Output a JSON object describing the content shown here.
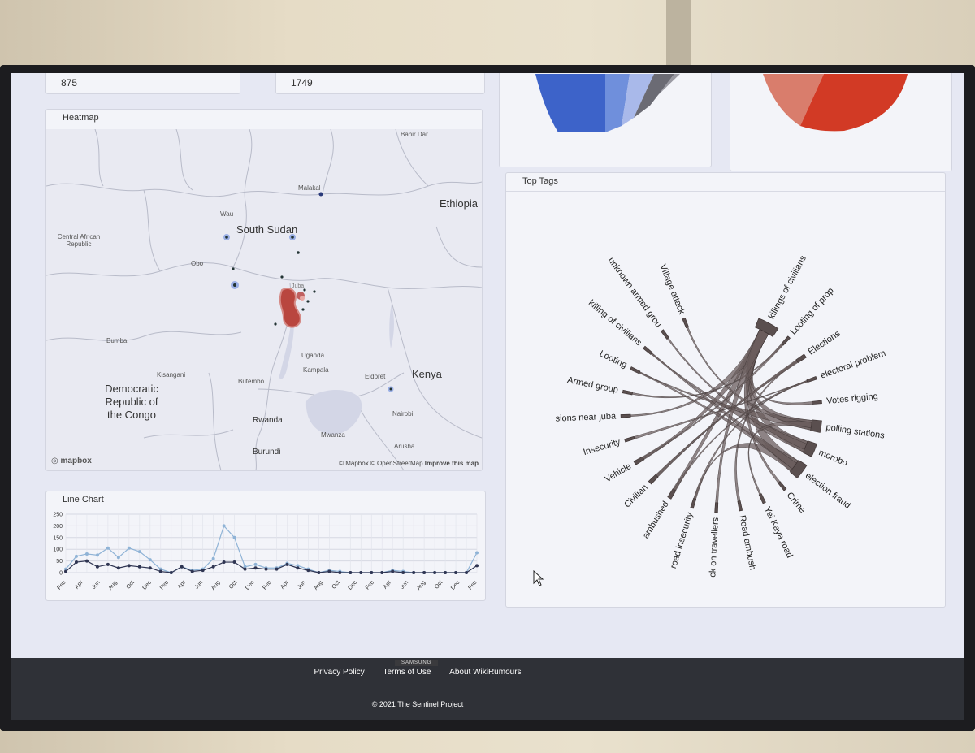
{
  "stats": {
    "left_value": "875",
    "right_value": "1749"
  },
  "heatmap": {
    "title": "Heatmap",
    "labels": {
      "south_sudan": "South Sudan",
      "ethiopia": "Ethiopia",
      "car": "Central African Republic",
      "drc": "Democratic Republic of the Congo",
      "uganda": "Uganda",
      "kenya": "Kenya",
      "rwanda": "Rwanda",
      "burundi": "Burundi",
      "bahir_dar": "Bahir Dar",
      "malakal": "Malakal",
      "wau": "Wau",
      "obo": "Obo",
      "bumba": "Bumba",
      "kisangani": "Kisangani",
      "butembo": "Butembo",
      "kampala": "Kampala",
      "eldoret": "Eldoret",
      "nairobi": "Nairobi",
      "mwanza": "Mwanza",
      "arusha": "Arusha",
      "juba": "Juba"
    },
    "logo": "mapbox",
    "attribution": {
      "mapbox": "© Mapbox",
      "osm": "© OpenStreetMap",
      "improve": "Improve this map"
    }
  },
  "line_chart": {
    "title": "Line Chart",
    "chart_data": {
      "type": "line",
      "y_ticks": [
        0,
        50,
        100,
        150,
        200,
        250
      ],
      "ylim": [
        0,
        250
      ],
      "x_labels": [
        "Feb",
        "Apr",
        "Jun",
        "Aug",
        "Oct",
        "Dec",
        "Feb",
        "Apr",
        "Jun",
        "Aug",
        "Oct",
        "Dec",
        "Feb",
        "Apr",
        "Jun",
        "Aug",
        "Oct",
        "Dec",
        "Feb",
        "Apr",
        "Jun",
        "Aug",
        "Oct",
        "Dec",
        "Feb"
      ],
      "series": [
        {
          "color": "#8fb3d6",
          "values": [
            15,
            70,
            80,
            75,
            105,
            65,
            105,
            90,
            55,
            15,
            0,
            25,
            10,
            15,
            60,
            200,
            150,
            25,
            35,
            20,
            20,
            40,
            30,
            15,
            0,
            10,
            5,
            0,
            0,
            0,
            0,
            10,
            5,
            0,
            0,
            0,
            0,
            0,
            0,
            85
          ]
        },
        {
          "color": "#2f3552",
          "values": [
            5,
            45,
            50,
            25,
            35,
            20,
            30,
            25,
            20,
            5,
            0,
            25,
            5,
            10,
            25,
            45,
            45,
            15,
            20,
            15,
            15,
            35,
            20,
            10,
            0,
            5,
            0,
            0,
            0,
            0,
            0,
            5,
            0,
            0,
            0,
            0,
            0,
            0,
            0,
            30
          ]
        }
      ]
    }
  },
  "top_tags": {
    "title": "Top Tags",
    "chart_data": {
      "type": "chord",
      "groups": [
        "killings of civilians",
        "Looting of prop",
        "Elections",
        "electoral problem",
        "Votes rigging",
        "polling stations",
        "morobo",
        "election fraud",
        "Crime",
        "Yei Kaya road",
        "Road ambush",
        "ck on travellers",
        "road insecurity",
        "ambushed",
        "Civilian",
        "Vehicle",
        "Insecurity",
        "sions near juba",
        "Armed group",
        "Looting",
        "killing of civilians",
        "unknown armed grou",
        "Village attack"
      ]
    }
  },
  "footer": {
    "privacy": "Privacy Policy",
    "terms": "Terms of Use",
    "about": "About WikiRumours",
    "copyright": "© 2021 The Sentinel Project"
  },
  "tv_brand": "SAMSUNG",
  "colors": {
    "footer_bg": "#2f3137",
    "pie_blue": "#3d63c9",
    "pie_red": "#d23a25",
    "chord": "#6b5e5e"
  }
}
